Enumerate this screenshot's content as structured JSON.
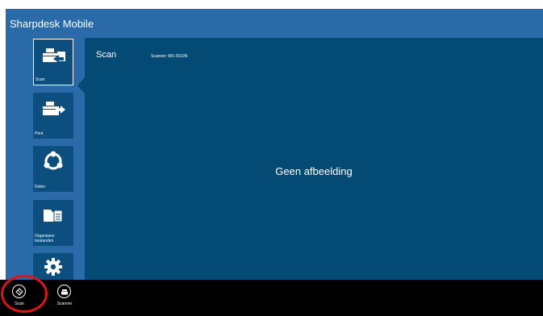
{
  "app": {
    "title": "Sharpdesk Mobile"
  },
  "content": {
    "title": "Scan",
    "scanner_label": "Scanner: MX-2610N",
    "empty_message": "Geen afbeelding"
  },
  "nav": {
    "items": [
      {
        "label": "Scan",
        "icon": "scan-icon",
        "selected": true
      },
      {
        "label": "Print",
        "icon": "print-icon",
        "selected": false
      },
      {
        "label": "Delen",
        "icon": "share-icon",
        "selected": false
      },
      {
        "label": "Organiseer\nbestanden",
        "icon": "folder-icon",
        "selected": false
      },
      {
        "label": "",
        "icon": "gear-icon",
        "selected": false
      }
    ]
  },
  "appbar": {
    "scan_label": "Scan",
    "scanner_label": "Scanner"
  },
  "colors": {
    "app_background": "#2a6aa8",
    "content_background": "#034a75",
    "highlight_ring": "#e01414"
  }
}
